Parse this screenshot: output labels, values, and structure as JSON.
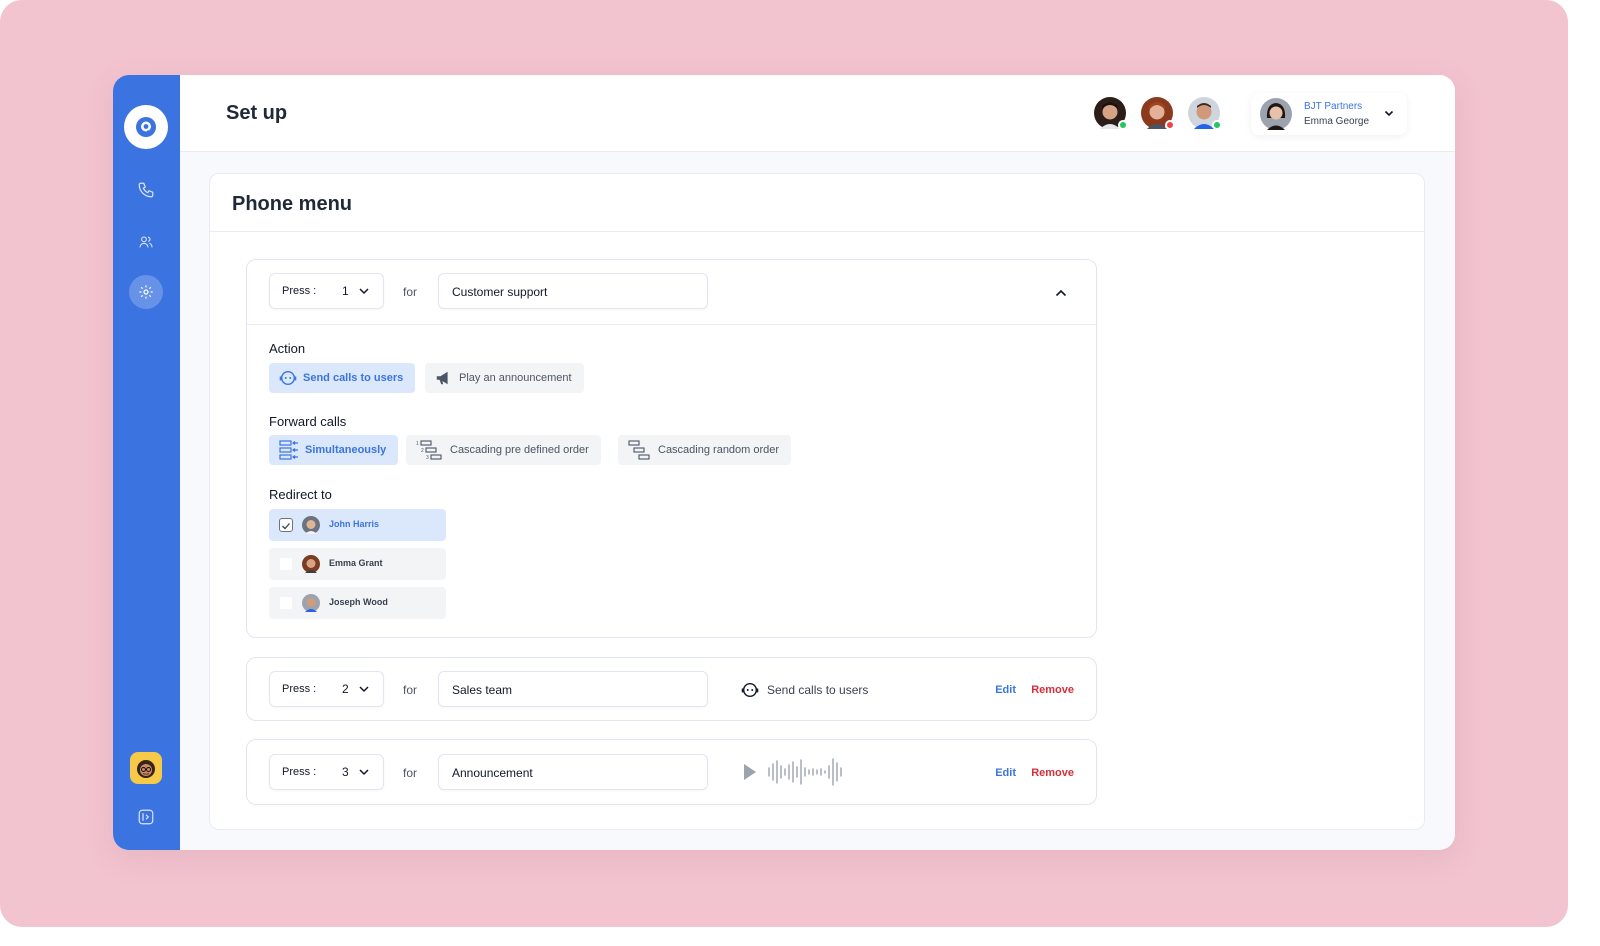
{
  "header": {
    "title": "Set up"
  },
  "account": {
    "company": "BJT Partners",
    "user_name": "Emma George"
  },
  "team_status": [
    {
      "name": "team-member-1",
      "status_color": "#22c55e"
    },
    {
      "name": "team-member-2",
      "status_color": "#ef4444"
    },
    {
      "name": "team-member-3",
      "status_color": "#22c55e"
    }
  ],
  "colors": {
    "accent": "#3b74e0",
    "backdrop": "#f2c4cf",
    "danger": "#d62f3a",
    "active_chip": "#dbe8fb"
  },
  "sidebar": {
    "icons": [
      "logo-icon",
      "phone-icon",
      "users-icon",
      "settings-icon",
      "avatar",
      "expand-icon"
    ],
    "active": "settings"
  },
  "phone_menu": {
    "title": "Phone menu",
    "press_label": "Press :",
    "for_label": "for",
    "items": [
      {
        "key": "1",
        "name": "Customer support",
        "expanded": true,
        "action_label": "Action",
        "actions": [
          {
            "label": "Send calls to users",
            "selected": true
          },
          {
            "label": "Play an announcement",
            "selected": false
          }
        ],
        "forward_label": "Forward calls",
        "forward_options": [
          {
            "label": "Simultaneously",
            "selected": true
          },
          {
            "label": "Cascading pre defined order",
            "selected": false
          },
          {
            "label": "Cascading random order",
            "selected": false
          }
        ],
        "redirect_label": "Redirect to",
        "users": [
          {
            "name": "John Harris",
            "checked": true
          },
          {
            "name": "Emma Grant",
            "checked": false
          },
          {
            "name": "Joseph Wood",
            "checked": false
          }
        ]
      },
      {
        "key": "2",
        "name": "Sales team",
        "summary": "Send calls to users",
        "edit": "Edit",
        "remove": "Remove"
      },
      {
        "key": "3",
        "name": "Announcement",
        "summary_type": "audio",
        "edit": "Edit",
        "remove": "Remove"
      }
    ]
  }
}
